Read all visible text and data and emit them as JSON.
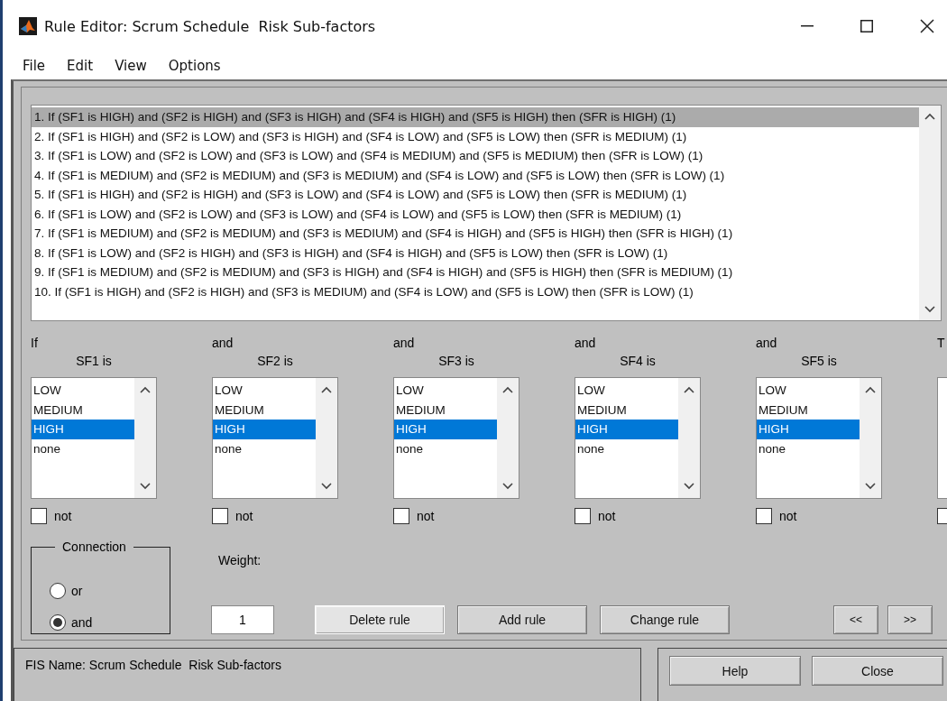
{
  "window": {
    "title": "Rule Editor: Scrum Schedule  Risk Sub-factors"
  },
  "menu": [
    "File",
    "Edit",
    "View",
    "Options"
  ],
  "rules": [
    {
      "text": "1. If (SF1 is HIGH) and (SF2 is HIGH) and (SF3 is HIGH) and (SF4 is HIGH) and (SF5 is HIGH) then (SFR is HIGH) (1)",
      "selected": true
    },
    {
      "text": "2. If (SF1 is HIGH) and (SF2 is LOW) and (SF3 is HIGH) and (SF4 is LOW) and (SF5 is LOW) then (SFR is MEDIUM) (1)",
      "selected": false
    },
    {
      "text": "3. If (SF1 is LOW) and (SF2 is LOW) and (SF3 is LOW) and (SF4 is MEDIUM) and (SF5 is MEDIUM) then (SFR is LOW) (1)",
      "selected": false
    },
    {
      "text": "4. If (SF1 is MEDIUM) and (SF2 is MEDIUM) and (SF3 is MEDIUM) and (SF4 is LOW) and (SF5 is LOW) then (SFR is LOW) (1)",
      "selected": false
    },
    {
      "text": "5. If (SF1 is HIGH) and (SF2 is HIGH) and (SF3 is LOW) and (SF4 is LOW) and (SF5 is LOW) then (SFR is MEDIUM) (1)",
      "selected": false
    },
    {
      "text": "6. If (SF1 is LOW) and (SF2 is LOW) and (SF3 is LOW) and (SF4 is LOW) and (SF5 is LOW) then (SFR is MEDIUM) (1)",
      "selected": false
    },
    {
      "text": "7. If (SF1 is MEDIUM) and (SF2 is MEDIUM) and (SF3 is MEDIUM) and (SF4 is HIGH) and (SF5 is HIGH) then (SFR is HIGH) (1)",
      "selected": false
    },
    {
      "text": "8. If (SF1 is LOW) and (SF2 is HIGH) and (SF3 is HIGH) and (SF4 is HIGH) and (SF5 is LOW) then (SFR is LOW) (1)",
      "selected": false
    },
    {
      "text": "9. If (SF1 is MEDIUM) and (SF2 is MEDIUM) and (SF3 is HIGH) and (SF4 is HIGH) and (SF5 is HIGH) then (SFR is MEDIUM) (1)",
      "selected": false
    },
    {
      "text": "10. If (SF1 is HIGH) and (SF2 is HIGH) and (SF3 is MEDIUM) and (SF4 is LOW) and (SF5 is LOW) then (SFR is LOW) (1)",
      "selected": false
    }
  ],
  "inputs": [
    {
      "connector": "If",
      "label": "SF1 is",
      "options": [
        {
          "label": "LOW",
          "selected": false
        },
        {
          "label": "MEDIUM",
          "selected": false
        },
        {
          "label": "HIGH",
          "selected": true
        },
        {
          "label": "none",
          "selected": false
        }
      ],
      "not_label": "not",
      "not_checked": false
    },
    {
      "connector": "and",
      "label": "SF2 is",
      "options": [
        {
          "label": "LOW",
          "selected": false
        },
        {
          "label": "MEDIUM",
          "selected": false
        },
        {
          "label": "HIGH",
          "selected": true
        },
        {
          "label": "none",
          "selected": false
        }
      ],
      "not_label": "not",
      "not_checked": false
    },
    {
      "connector": "and",
      "label": "SF3 is",
      "options": [
        {
          "label": "LOW",
          "selected": false
        },
        {
          "label": "MEDIUM",
          "selected": false
        },
        {
          "label": "HIGH",
          "selected": true
        },
        {
          "label": "none",
          "selected": false
        }
      ],
      "not_label": "not",
      "not_checked": false
    },
    {
      "connector": "and",
      "label": "SF4 is",
      "options": [
        {
          "label": "LOW",
          "selected": false
        },
        {
          "label": "MEDIUM",
          "selected": false
        },
        {
          "label": "HIGH",
          "selected": true
        },
        {
          "label": "none",
          "selected": false
        }
      ],
      "not_label": "not",
      "not_checked": false
    },
    {
      "connector": "and",
      "label": "SF5 is",
      "options": [
        {
          "label": "LOW",
          "selected": false
        },
        {
          "label": "MEDIUM",
          "selected": false
        },
        {
          "label": "HIGH",
          "selected": true
        },
        {
          "label": "none",
          "selected": false
        }
      ],
      "not_label": "not",
      "not_checked": false
    },
    {
      "connector": "T",
      "not_checked": false
    }
  ],
  "connection": {
    "title": "Connection",
    "options": [
      {
        "label": "or",
        "selected": false
      },
      {
        "label": "and",
        "selected": true
      }
    ]
  },
  "weight": {
    "label": "Weight:",
    "value": "1"
  },
  "buttons": [
    {
      "label": "Delete rule",
      "focused": true
    },
    {
      "label": "Add rule",
      "focused": false
    },
    {
      "label": "Change rule",
      "focused": false
    }
  ],
  "nav_buttons": [
    "<<",
    ">>"
  ],
  "status": "FIS Name: Scrum Schedule  Risk Sub-factors",
  "footer_buttons": [
    "Help",
    "Close"
  ]
}
